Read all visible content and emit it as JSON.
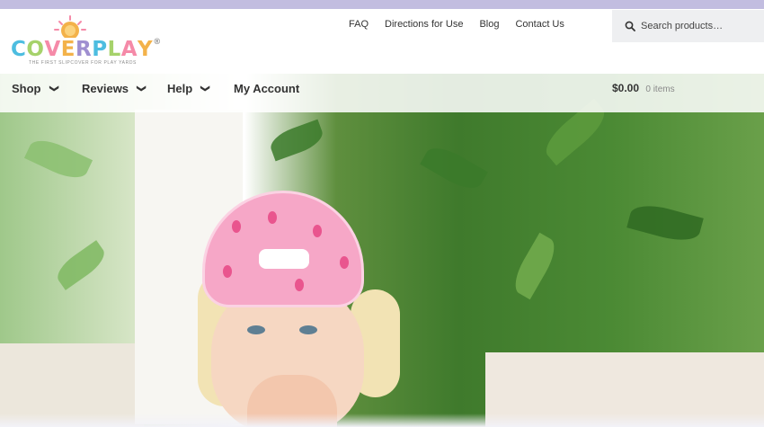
{
  "brand": {
    "logo_letters": [
      "C",
      "O",
      "V",
      "E",
      "R",
      "P",
      "L",
      "A",
      "Y"
    ],
    "logo_colors": [
      "#4dbde0",
      "#a6d26b",
      "#f58aa8",
      "#f3b24a",
      "#9f8fd0",
      "#4dbde0",
      "#a6d26b",
      "#f58aa8",
      "#f3b24a"
    ],
    "registered": "®",
    "tagline": "THE FIRST SLIPCOVER FOR PLAY YARDS"
  },
  "top_links": [
    "FAQ",
    "Directions for Use",
    "Blog",
    "Contact Us"
  ],
  "search": {
    "placeholder": "Search products…",
    "icon": "search-icon"
  },
  "nav": {
    "items": [
      {
        "label": "Shop",
        "has_dropdown": true
      },
      {
        "label": "Reviews",
        "has_dropdown": true
      },
      {
        "label": "Help",
        "has_dropdown": true
      },
      {
        "label": "My Account",
        "has_dropdown": false
      }
    ],
    "chevron": "❯"
  },
  "cart": {
    "amount": "$0.00",
    "count": "0 items"
  },
  "colors": {
    "top_strip": "#c2bde0",
    "search_bg": "#eeeff1",
    "text": "#333333"
  }
}
